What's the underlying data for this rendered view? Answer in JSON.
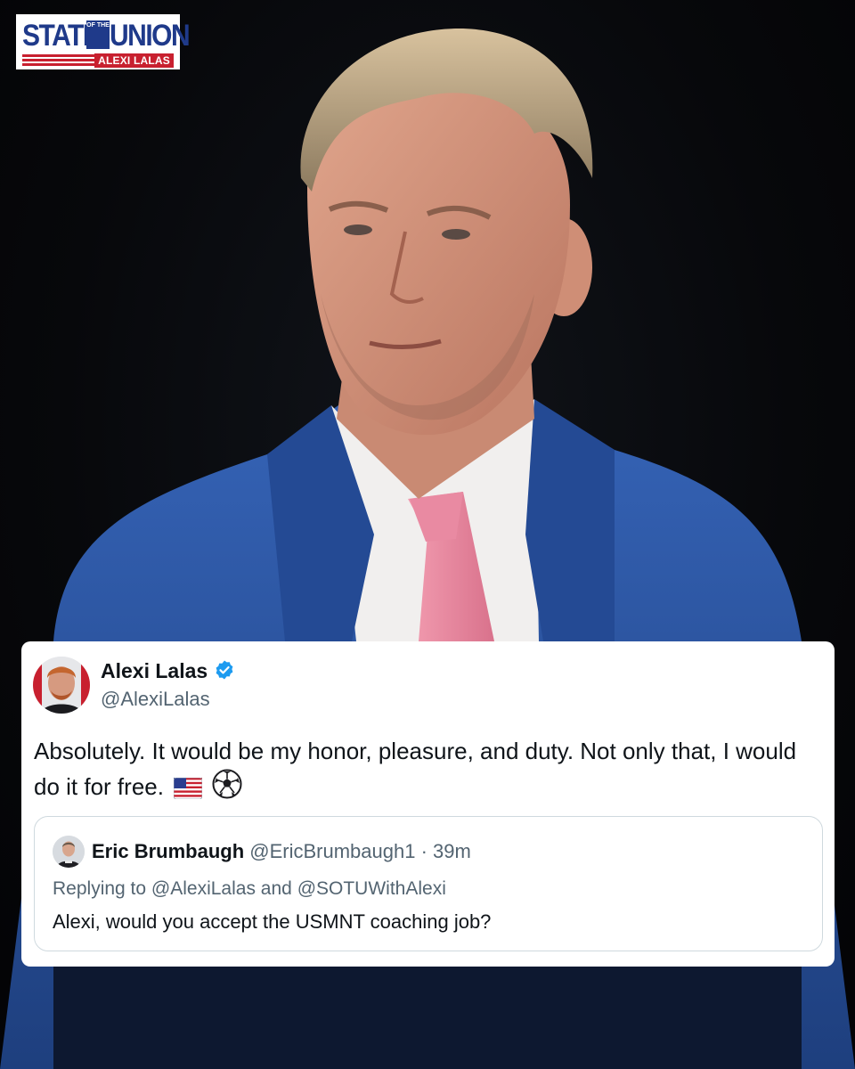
{
  "logo": {
    "word_left": "STATE",
    "word_mid": "OF THE",
    "word_right": "UNION",
    "host": "ALEXI LALAS"
  },
  "tweet": {
    "author_name": "Alexi Lalas",
    "author_handle": "@AlexiLalas",
    "verified_icon": "verified-badge-icon",
    "text": "Absolutely. It would be my honor, pleasure, and duty. Not only that, I would do it for free.",
    "emojis": [
      "us-flag-icon",
      "soccer-ball-icon"
    ]
  },
  "quoted_tweet": {
    "author_name": "Eric Brumbaugh",
    "author_handle": "@EricBrumbaugh1",
    "separator": "·",
    "time": "39m",
    "reply_prefix": "Replying to",
    "reply_mention_1": "@AlexiLalas",
    "reply_and": "and",
    "reply_mention_2": "@SOTUWithAlexi",
    "text": "Alexi, would you accept the USMNT coaching job?"
  },
  "colors": {
    "brand_blue": "#1f3a8a",
    "brand_red": "#c8202f",
    "suit_blue": "#2c56a8",
    "tie_pink": "#e88aa0",
    "verified_blue": "#1d9bf0",
    "text_dark": "#0f1419",
    "text_gray": "#536471"
  }
}
